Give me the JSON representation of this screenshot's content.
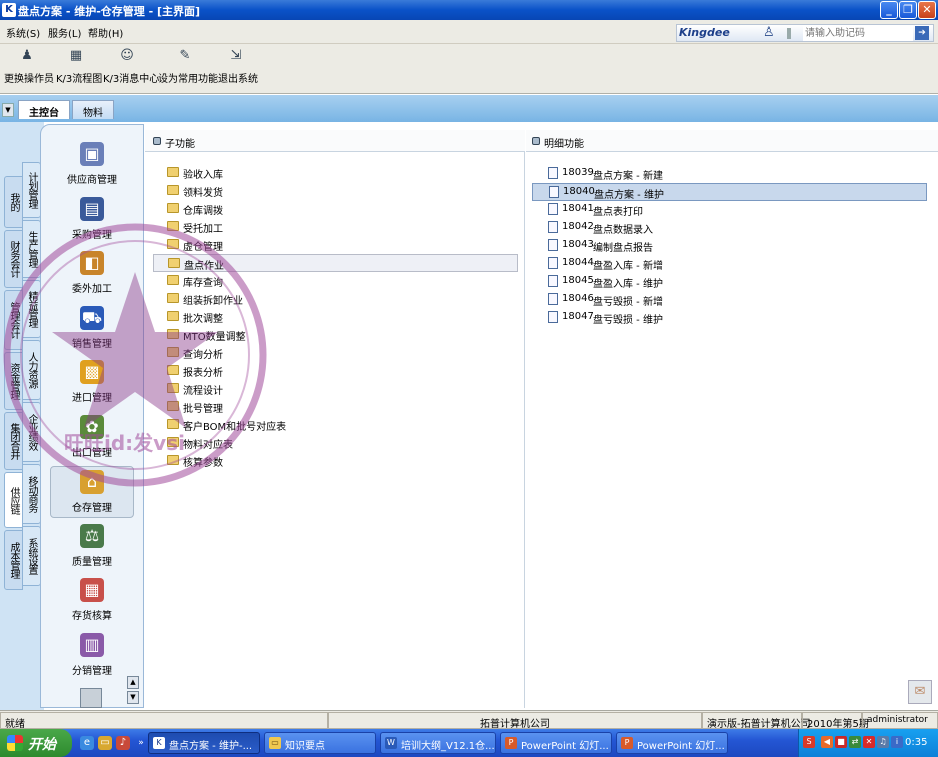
{
  "window": {
    "app_icon": "K",
    "title": "盘点方案 - 维护-仓存管理 - [主界面]",
    "buttons": {
      "minimize": "_",
      "restore": "❐",
      "close": "✕"
    }
  },
  "menubar": {
    "items": [
      "系统(S)",
      "服务(L)",
      "帮助(H)"
    ],
    "brand": "Kingdee",
    "help_placeholder": "请输入助记码"
  },
  "toolbar": {
    "items": [
      {
        "label": "更换操作员",
        "icon": "user-switch-icon"
      },
      {
        "label": "K/3流程图",
        "icon": "flowchart-icon"
      },
      {
        "label": "K/3消息中心",
        "icon": "message-center-icon"
      },
      {
        "label": "设为常用功能",
        "icon": "favorite-icon"
      },
      {
        "label": "退出系统",
        "icon": "exit-icon"
      }
    ]
  },
  "tabs": [
    {
      "label": "主控台",
      "active": true
    },
    {
      "label": "物料",
      "active": false
    }
  ],
  "sidebar_vertical_tabs": {
    "col1": [
      "我的K/3",
      "财务会计",
      "管理会计",
      "资金管理",
      "集团合并",
      "供应链",
      "成本管理"
    ],
    "col2": [
      "计划管理",
      "生产管理",
      "精益管理",
      "人力资源",
      "企业绩效",
      "移动商务",
      "系统设置"
    ],
    "active": "供应链"
  },
  "modules": [
    {
      "label": "供应商管理",
      "icon": "supplier-icon",
      "color": "#6a7fb8"
    },
    {
      "label": "采购管理",
      "icon": "purchase-icon",
      "color": "#3a5a9a"
    },
    {
      "label": "委外加工",
      "icon": "outsourcing-icon",
      "color": "#c8842a"
    },
    {
      "label": "销售管理",
      "icon": "truck-icon",
      "color": "#2a5ab8"
    },
    {
      "label": "进口管理",
      "icon": "import-box-icon",
      "color": "#e0a020"
    },
    {
      "label": "出口管理",
      "icon": "export-icon",
      "color": "#5a8a3a"
    },
    {
      "label": "仓存管理",
      "icon": "warehouse-icon",
      "color": "#d8a030",
      "selected": true
    },
    {
      "label": "质量管理",
      "icon": "quality-icon",
      "color": "#4a7a4a"
    },
    {
      "label": "存货核算",
      "icon": "inventory-accounting-icon",
      "color": "#c8504a"
    },
    {
      "label": "分销管理",
      "icon": "distribution-icon",
      "color": "#8a5aa8"
    }
  ],
  "sub_functions": {
    "header": "子功能",
    "items": [
      "验收入库",
      "领料发货",
      "仓库调拨",
      "受托加工",
      "虚仓管理",
      "盘点作业",
      "库存查询",
      "组装拆卸作业",
      "批次调整",
      "MTO数量调整",
      "查询分析",
      "报表分析",
      "流程设计",
      "批号管理",
      "客户BOM和批号对应表",
      "物料对应表",
      "核算参数"
    ],
    "selected": "盘点作业"
  },
  "detail_functions": {
    "header": "明细功能",
    "items": [
      {
        "code": "18039",
        "label": "盘点方案 - 新建"
      },
      {
        "code": "18040",
        "label": "盘点方案 - 维护"
      },
      {
        "code": "18041",
        "label": "盘点表打印"
      },
      {
        "code": "18042",
        "label": "盘点数据录入"
      },
      {
        "code": "18043",
        "label": "编制盘点报告"
      },
      {
        "code": "18044",
        "label": "盘盈入库 - 新增"
      },
      {
        "code": "18045",
        "label": "盘盈入库 - 维护"
      },
      {
        "code": "18046",
        "label": "盘亏毁损 - 新增"
      },
      {
        "code": "18047",
        "label": "盘亏毁损 - 维护"
      }
    ],
    "selected_code": "18040"
  },
  "statusbar": {
    "ready": "就绪",
    "company": "拓普计算机公司",
    "edition": "演示版-拓普计算机公司",
    "period": "2010年第5期",
    "user": "administrator"
  },
  "taskbar": {
    "start": "开始",
    "tasks": [
      {
        "label": "盘点方案 - 维护-...",
        "icon": "kingdee-icon",
        "active": true
      },
      {
        "label": "知识要点",
        "icon": "folder-icon",
        "active": false
      },
      {
        "label": "培训大纲_V12.1仓...",
        "icon": "word-icon",
        "active": false
      },
      {
        "label": "PowerPoint 幻灯...",
        "icon": "powerpoint-icon",
        "active": false
      },
      {
        "label": "PowerPoint 幻灯...",
        "icon": "powerpoint-icon",
        "active": false
      }
    ],
    "clock": "0:35"
  },
  "watermark_text": "旺旺id:发vsi"
}
